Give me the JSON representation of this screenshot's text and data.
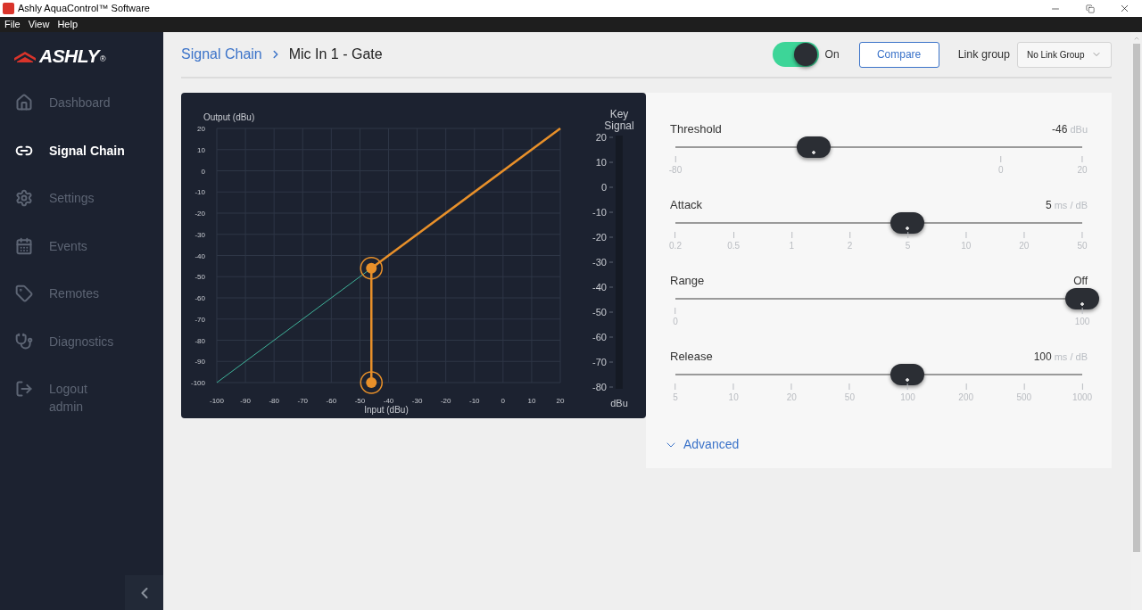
{
  "window": {
    "title": "Ashly AquaControl™ Software"
  },
  "menu": [
    "File",
    "View",
    "Help"
  ],
  "sidebar": {
    "logo": "ASHLY",
    "logo_mark": "®",
    "items": [
      {
        "kind": "home",
        "label": "Dashboard",
        "selected": false
      },
      {
        "kind": "link",
        "label": "Signal Chain",
        "selected": true
      },
      {
        "kind": "gear",
        "label": "Settings",
        "selected": false
      },
      {
        "kind": "calendar",
        "label": "Events",
        "selected": false
      },
      {
        "kind": "remote",
        "label": "Remotes",
        "selected": false
      },
      {
        "kind": "stethoscope",
        "label": "Diagnostics",
        "selected": false
      },
      {
        "kind": "logout",
        "label": "Logout",
        "sublabel": "admin",
        "selected": false
      }
    ]
  },
  "breadcrumb": {
    "parent": "Signal Chain",
    "current": "Mic In 1 - Gate"
  },
  "power": {
    "on": true,
    "label": "On"
  },
  "compare_button": "Compare",
  "link_group": {
    "label": "Link group",
    "value": "No Link Group"
  },
  "chart": {
    "chart_data": {
      "type": "line",
      "ylabel": "Output (dBu)",
      "xlabel": "Input (dBu)",
      "x": [
        -100,
        -46,
        -46,
        20
      ],
      "series": [
        {
          "color": "#3fb39a",
          "values": [
            -100,
            -46,
            null,
            null
          ]
        },
        {
          "color": "#e8902a",
          "values": [
            null,
            -100,
            -46,
            20
          ]
        }
      ],
      "xlim": [
        -100,
        20
      ],
      "ylim": [
        -100,
        20
      ],
      "xticks": [
        -100,
        -90,
        -80,
        -70,
        -60,
        -50,
        -40,
        -30,
        -20,
        -10,
        0,
        10,
        20
      ],
      "yticks": [
        -100,
        -90,
        -80,
        -70,
        -60,
        -50,
        -40,
        -30,
        -20,
        -10,
        0,
        10,
        20
      ],
      "grid": true
    },
    "key_meter": {
      "title": "Key Signal",
      "ticks": [
        "20",
        "10",
        "0",
        "-10",
        "-20",
        "-30",
        "-40",
        "-50",
        "-60",
        "-70",
        "-80"
      ],
      "unit": "dBu"
    }
  },
  "sliders": [
    {
      "label": "Threshold",
      "value": "-46",
      "unit": "dBu",
      "level": 0.34,
      "ticks": [
        "-80",
        "0",
        "20"
      ]
    },
    {
      "label": "Attack",
      "value": "5",
      "unit": "ms / dB",
      "level": 0.57,
      "ticks": [
        "0.2",
        "0.5",
        "1",
        "2",
        "5",
        "10",
        "20",
        "50"
      ]
    },
    {
      "label": "Range",
      "value": "Off",
      "level": 1,
      "ticks": [
        "0",
        "100"
      ]
    },
    {
      "label": "Release",
      "value": "100",
      "unit": "ms / dB",
      "level": 0.57,
      "ticks": [
        "5",
        "10",
        "20",
        "50",
        "100",
        "200",
        "500",
        "1000"
      ]
    }
  ],
  "advanced": {
    "label": "Advanced",
    "expanded": false
  }
}
